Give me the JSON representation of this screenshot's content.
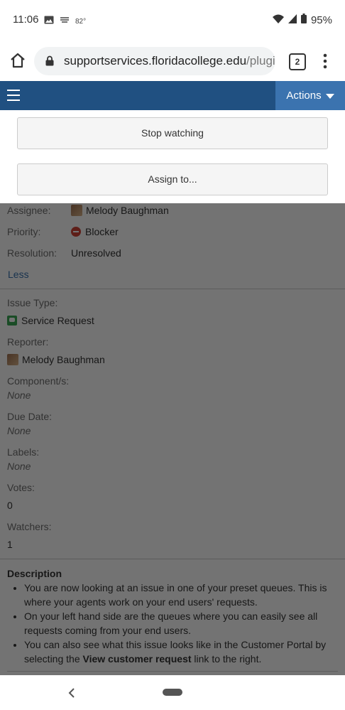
{
  "status_bar": {
    "time": "11:06",
    "temperature": "82°",
    "battery": "95%",
    "icons": [
      "image-icon",
      "weather-icon",
      "wifi-icon",
      "signal-icon",
      "battery-icon"
    ]
  },
  "browser": {
    "url_main": "supportservices.floridacollege.edu",
    "url_rest": "/plugi",
    "tab_count": "2"
  },
  "app_nav": {
    "actions_label": "Actions"
  },
  "dropdown": {
    "items": [
      {
        "label": "Stop watching"
      },
      {
        "label": "Assign to..."
      }
    ]
  },
  "details": {
    "assignee_label": "Assignee:",
    "assignee_value": "Melody Baughman",
    "priority_label": "Priority:",
    "priority_value": "Blocker",
    "resolution_label": "Resolution:",
    "resolution_value": "Unresolved",
    "less_link": "Less"
  },
  "people": {
    "issue_type_label": "Issue Type:",
    "issue_type_value": "Service Request",
    "reporter_label": "Reporter:",
    "reporter_value": "Melody Baughman",
    "components_label": "Component/s:",
    "components_value": "None",
    "due_date_label": "Due Date:",
    "due_date_value": "None",
    "labels_label": "Labels:",
    "labels_value": "None",
    "votes_label": "Votes:",
    "votes_value": "0",
    "watchers_label": "Watchers:",
    "watchers_value": "1"
  },
  "description": {
    "title": "Description",
    "item1": "You are now looking at an issue in one of your preset queues. This is where your agents work on your end users' requests.",
    "item2": "On your left hand side are the queues where you can easily see all requests coming from your end users.",
    "item3_before": "You can also see what this issue looks like in the Customer Portal by selecting the ",
    "item3_bold": "View customer request",
    "item3_after": " link to the right."
  },
  "colors": {
    "nav_bar": "#205081",
    "actions_button": "#3b73af",
    "link": "#3b73af",
    "blocker": "#d04437",
    "service_request": "#3aa856"
  }
}
